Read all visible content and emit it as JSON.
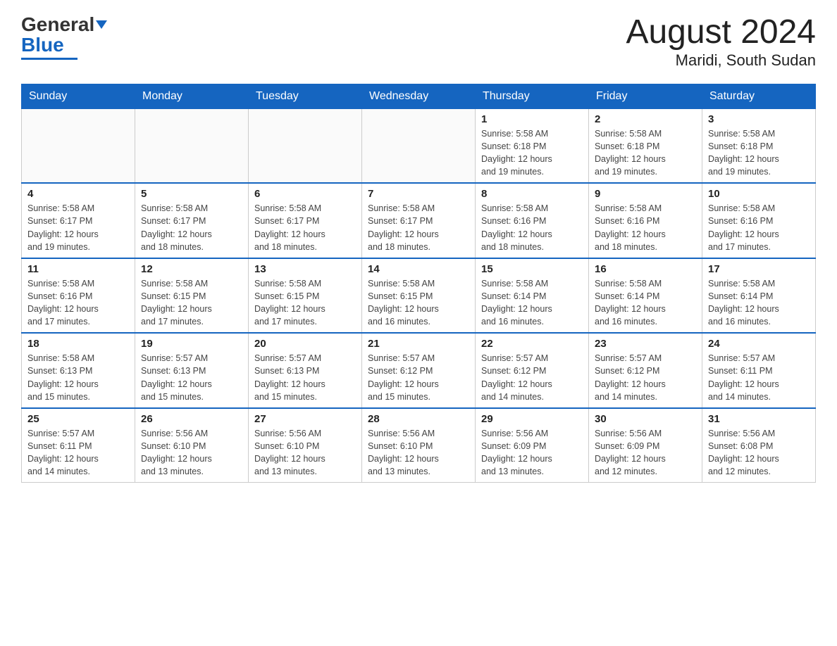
{
  "logo": {
    "general": "General",
    "blue": "Blue"
  },
  "header": {
    "month": "August 2024",
    "location": "Maridi, South Sudan"
  },
  "weekdays": [
    "Sunday",
    "Monday",
    "Tuesday",
    "Wednesday",
    "Thursday",
    "Friday",
    "Saturday"
  ],
  "weeks": [
    [
      {
        "day": "",
        "info": ""
      },
      {
        "day": "",
        "info": ""
      },
      {
        "day": "",
        "info": ""
      },
      {
        "day": "",
        "info": ""
      },
      {
        "day": "1",
        "info": "Sunrise: 5:58 AM\nSunset: 6:18 PM\nDaylight: 12 hours\nand 19 minutes."
      },
      {
        "day": "2",
        "info": "Sunrise: 5:58 AM\nSunset: 6:18 PM\nDaylight: 12 hours\nand 19 minutes."
      },
      {
        "day": "3",
        "info": "Sunrise: 5:58 AM\nSunset: 6:18 PM\nDaylight: 12 hours\nand 19 minutes."
      }
    ],
    [
      {
        "day": "4",
        "info": "Sunrise: 5:58 AM\nSunset: 6:17 PM\nDaylight: 12 hours\nand 19 minutes."
      },
      {
        "day": "5",
        "info": "Sunrise: 5:58 AM\nSunset: 6:17 PM\nDaylight: 12 hours\nand 18 minutes."
      },
      {
        "day": "6",
        "info": "Sunrise: 5:58 AM\nSunset: 6:17 PM\nDaylight: 12 hours\nand 18 minutes."
      },
      {
        "day": "7",
        "info": "Sunrise: 5:58 AM\nSunset: 6:17 PM\nDaylight: 12 hours\nand 18 minutes."
      },
      {
        "day": "8",
        "info": "Sunrise: 5:58 AM\nSunset: 6:16 PM\nDaylight: 12 hours\nand 18 minutes."
      },
      {
        "day": "9",
        "info": "Sunrise: 5:58 AM\nSunset: 6:16 PM\nDaylight: 12 hours\nand 18 minutes."
      },
      {
        "day": "10",
        "info": "Sunrise: 5:58 AM\nSunset: 6:16 PM\nDaylight: 12 hours\nand 17 minutes."
      }
    ],
    [
      {
        "day": "11",
        "info": "Sunrise: 5:58 AM\nSunset: 6:16 PM\nDaylight: 12 hours\nand 17 minutes."
      },
      {
        "day": "12",
        "info": "Sunrise: 5:58 AM\nSunset: 6:15 PM\nDaylight: 12 hours\nand 17 minutes."
      },
      {
        "day": "13",
        "info": "Sunrise: 5:58 AM\nSunset: 6:15 PM\nDaylight: 12 hours\nand 17 minutes."
      },
      {
        "day": "14",
        "info": "Sunrise: 5:58 AM\nSunset: 6:15 PM\nDaylight: 12 hours\nand 16 minutes."
      },
      {
        "day": "15",
        "info": "Sunrise: 5:58 AM\nSunset: 6:14 PM\nDaylight: 12 hours\nand 16 minutes."
      },
      {
        "day": "16",
        "info": "Sunrise: 5:58 AM\nSunset: 6:14 PM\nDaylight: 12 hours\nand 16 minutes."
      },
      {
        "day": "17",
        "info": "Sunrise: 5:58 AM\nSunset: 6:14 PM\nDaylight: 12 hours\nand 16 minutes."
      }
    ],
    [
      {
        "day": "18",
        "info": "Sunrise: 5:58 AM\nSunset: 6:13 PM\nDaylight: 12 hours\nand 15 minutes."
      },
      {
        "day": "19",
        "info": "Sunrise: 5:57 AM\nSunset: 6:13 PM\nDaylight: 12 hours\nand 15 minutes."
      },
      {
        "day": "20",
        "info": "Sunrise: 5:57 AM\nSunset: 6:13 PM\nDaylight: 12 hours\nand 15 minutes."
      },
      {
        "day": "21",
        "info": "Sunrise: 5:57 AM\nSunset: 6:12 PM\nDaylight: 12 hours\nand 15 minutes."
      },
      {
        "day": "22",
        "info": "Sunrise: 5:57 AM\nSunset: 6:12 PM\nDaylight: 12 hours\nand 14 minutes."
      },
      {
        "day": "23",
        "info": "Sunrise: 5:57 AM\nSunset: 6:12 PM\nDaylight: 12 hours\nand 14 minutes."
      },
      {
        "day": "24",
        "info": "Sunrise: 5:57 AM\nSunset: 6:11 PM\nDaylight: 12 hours\nand 14 minutes."
      }
    ],
    [
      {
        "day": "25",
        "info": "Sunrise: 5:57 AM\nSunset: 6:11 PM\nDaylight: 12 hours\nand 14 minutes."
      },
      {
        "day": "26",
        "info": "Sunrise: 5:56 AM\nSunset: 6:10 PM\nDaylight: 12 hours\nand 13 minutes."
      },
      {
        "day": "27",
        "info": "Sunrise: 5:56 AM\nSunset: 6:10 PM\nDaylight: 12 hours\nand 13 minutes."
      },
      {
        "day": "28",
        "info": "Sunrise: 5:56 AM\nSunset: 6:10 PM\nDaylight: 12 hours\nand 13 minutes."
      },
      {
        "day": "29",
        "info": "Sunrise: 5:56 AM\nSunset: 6:09 PM\nDaylight: 12 hours\nand 13 minutes."
      },
      {
        "day": "30",
        "info": "Sunrise: 5:56 AM\nSunset: 6:09 PM\nDaylight: 12 hours\nand 12 minutes."
      },
      {
        "day": "31",
        "info": "Sunrise: 5:56 AM\nSunset: 6:08 PM\nDaylight: 12 hours\nand 12 minutes."
      }
    ]
  ]
}
